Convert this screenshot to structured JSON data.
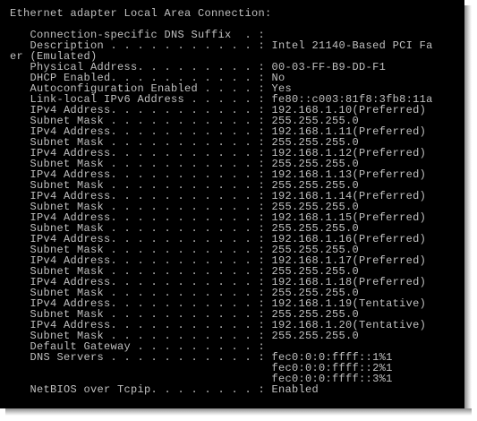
{
  "console": {
    "lines": [
      "Ethernet adapter Local Area Connection:",
      "",
      "   Connection-specific DNS Suffix  . :",
      "   Description . . . . . . . . . . . : Intel 21140-Based PCI Fa",
      "er (Emulated)",
      "   Physical Address. . . . . . . . . : 00-03-FF-B9-DD-F1",
      "   DHCP Enabled. . . . . . . . . . . : No",
      "   Autoconfiguration Enabled . . . . : Yes",
      "   Link-local IPv6 Address . . . . . : fe80::c003:81f8:3fb8:11a",
      "   IPv4 Address. . . . . . . . . . . : 192.168.1.10(Preferred)",
      "   Subnet Mask . . . . . . . . . . . : 255.255.255.0",
      "   IPv4 Address. . . . . . . . . . . : 192.168.1.11(Preferred)",
      "   Subnet Mask . . . . . . . . . . . : 255.255.255.0",
      "   IPv4 Address. . . . . . . . . . . : 192.168.1.12(Preferred)",
      "   Subnet Mask . . . . . . . . . . . : 255.255.255.0",
      "   IPv4 Address. . . . . . . . . . . : 192.168.1.13(Preferred)",
      "   Subnet Mask . . . . . . . . . . . : 255.255.255.0",
      "   IPv4 Address. . . . . . . . . . . : 192.168.1.14(Preferred)",
      "   Subnet Mask . . . . . . . . . . . : 255.255.255.0",
      "   IPv4 Address. . . . . . . . . . . : 192.168.1.15(Preferred)",
      "   Subnet Mask . . . . . . . . . . . : 255.255.255.0",
      "   IPv4 Address. . . . . . . . . . . : 192.168.1.16(Preferred)",
      "   Subnet Mask . . . . . . . . . . . : 255.255.255.0",
      "   IPv4 Address. . . . . . . . . . . : 192.168.1.17(Preferred)",
      "   Subnet Mask . . . . . . . . . . . : 255.255.255.0",
      "   IPv4 Address. . . . . . . . . . . : 192.168.1.18(Preferred)",
      "   Subnet Mask . . . . . . . . . . . : 255.255.255.0",
      "   IPv4 Address. . . . . . . . . . . : 192.168.1.19(Tentative)",
      "   Subnet Mask . . . . . . . . . . . : 255.255.255.0",
      "   IPv4 Address. . . . . . . . . . . : 192.168.1.20(Tentative)",
      "   Subnet Mask . . . . . . . . . . . : 255.255.255.0",
      "   Default Gateway . . . . . . . . . :",
      "   DNS Servers . . . . . . . . . . . : fec0:0:0:ffff::1%1",
      "                                       fec0:0:0:ffff::2%1",
      "                                       fec0:0:0:ffff::3%1",
      "   NetBIOS over Tcpip. . . . . . . . : Enabled"
    ]
  },
  "colors": {
    "background": "#000000",
    "text": "#c0c0c0"
  }
}
